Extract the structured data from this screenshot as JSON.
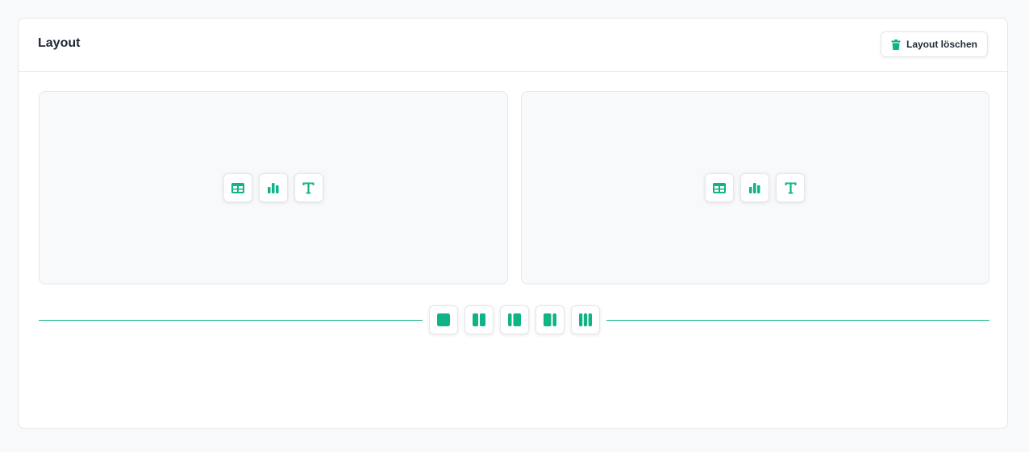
{
  "header": {
    "title": "Layout",
    "delete_label": "Layout löschen"
  },
  "slots": [
    {
      "options": [
        "table-icon",
        "bar-chart-icon",
        "text-icon"
      ]
    },
    {
      "options": [
        "table-icon",
        "bar-chart-icon",
        "text-icon"
      ]
    }
  ],
  "layout_options": [
    "single-column",
    "two-columns",
    "narrow-wide",
    "wide-narrow",
    "three-columns"
  ],
  "colors": {
    "accent": "#10b386",
    "border": "#e5e7eb",
    "slot_background": "#f8f9fb",
    "text": "#1f2937"
  }
}
